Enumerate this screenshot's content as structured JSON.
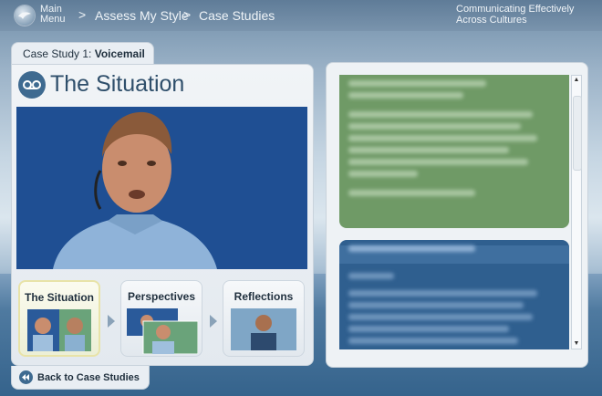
{
  "header": {
    "main_menu_line1": "Main",
    "main_menu_line2": "Menu",
    "sep1": ">",
    "crumb1": "Assess My Style",
    "sep2": ">",
    "crumb2": "Case Studies",
    "brand_line1": "Communicating Effectively",
    "brand_line2": "Across Cultures"
  },
  "tab": {
    "prefix": "Case Study 1: ",
    "name": "Voicemail"
  },
  "section": {
    "title": "The Situation",
    "icon": "voicemail-icon"
  },
  "thumbnails": [
    {
      "label": "The Situation",
      "active": true
    },
    {
      "label": "Perspectives",
      "active": false
    },
    {
      "label": "Reflections",
      "active": false
    }
  ],
  "back_button": {
    "label": "Back to Case Studies",
    "icon": "rewind-icon"
  },
  "colors": {
    "accent": "#3e6a90",
    "video_bg": "#1f4f93",
    "green_card": "#6f9a66",
    "blue_card": "#2f5f8f"
  }
}
